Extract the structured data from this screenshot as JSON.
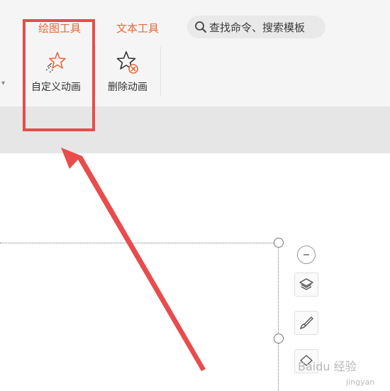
{
  "ribbon": {
    "tabs": [
      {
        "label": "绘图工具"
      },
      {
        "label": "文本工具"
      }
    ],
    "search": {
      "label": "查找命令、搜索模板"
    },
    "tools": [
      {
        "label": "自定义动画",
        "icon": "custom-animation-star-icon"
      },
      {
        "label": "删除动画",
        "icon": "delete-animation-star-icon"
      }
    ]
  },
  "side_toolbar": {
    "items": [
      {
        "icon": "collapse-minus-icon"
      },
      {
        "icon": "layers-icon"
      },
      {
        "icon": "brush-icon"
      },
      {
        "icon": "shape-fill-icon"
      }
    ]
  },
  "annotation": {
    "color": "#e84c4c"
  },
  "watermark": {
    "text": "Baidu 经验",
    "sub": "jingyan"
  },
  "colors": {
    "tab_accent": "#e56a3b",
    "ribbon_bg": "#f5f5f5",
    "band_bg": "#e6e6e6"
  }
}
